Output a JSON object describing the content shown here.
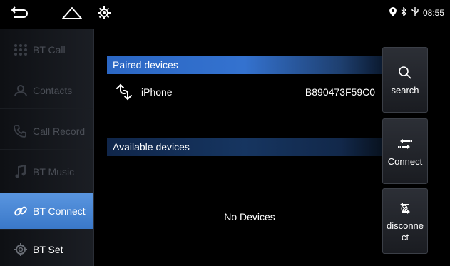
{
  "status_bar": {
    "time": "08:55",
    "icons": [
      "back-icon",
      "home-icon",
      "settings-gear-icon",
      "location-pin-icon",
      "bluetooth-icon",
      "usb-icon"
    ]
  },
  "sidebar": {
    "items": [
      {
        "label": "BT Call",
        "icon": "dialpad-icon",
        "active": false
      },
      {
        "label": "Contacts",
        "icon": "contacts-icon",
        "active": false
      },
      {
        "label": "Call Record",
        "icon": "call-record-icon",
        "active": false
      },
      {
        "label": "BT Music",
        "icon": "music-icon",
        "active": false
      },
      {
        "label": "BT Connect",
        "icon": "link-icon",
        "active": true
      },
      {
        "label": "BT Set",
        "icon": "gear-icon",
        "active": false
      }
    ]
  },
  "main": {
    "paired_title": "Paired devices",
    "paired_devices": [
      {
        "name": "iPhone",
        "address": "B890473F59C0",
        "icon": "phone-link-icon"
      }
    ],
    "available_title": "Available devices",
    "empty_text": "No Devices"
  },
  "actions": {
    "search_label": "search",
    "connect_label": "Connect",
    "disconnect_label": "disconne ct"
  },
  "colors": {
    "accent": "#3a78c8",
    "background": "#000000",
    "inactive_text": "#4a4e56"
  }
}
